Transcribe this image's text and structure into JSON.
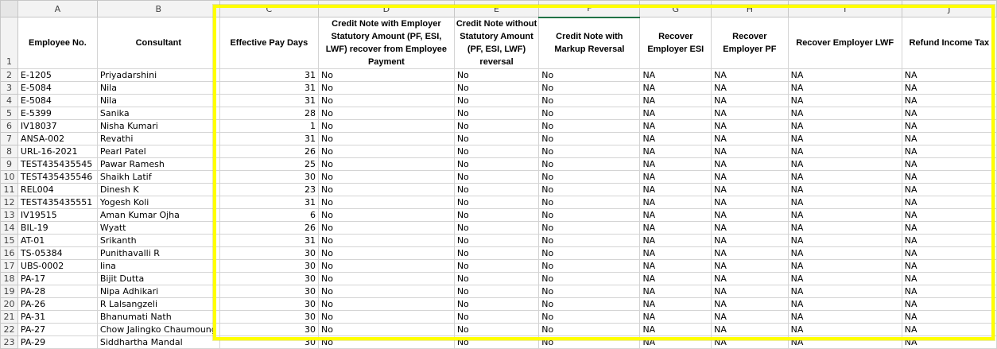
{
  "columns": [
    "A",
    "B",
    "C",
    "D",
    "E",
    "F",
    "G",
    "H",
    "I",
    "J"
  ],
  "header_row_number": "1",
  "headers": [
    "Employee No.",
    "Consultant",
    "Effective Pay Days",
    "Credit Note with Employer Statutory Amount (PF, ESI, LWF) recover from Employee Payment",
    "Credit Note without Statutory Amount (PF, ESI, LWF) reversal",
    "Credit Note with Markup Reversal",
    "Recover Employer ESI",
    "Recover Employer PF",
    "Recover Employer LWF",
    "Refund Income Tax"
  ],
  "rows": [
    {
      "num": "2",
      "emp": "E-1205",
      "consultant": "Priyadarshini",
      "days": "31",
      "d": "No",
      "e": "No",
      "f": "No",
      "g": "NA",
      "h": "NA",
      "i": "NA",
      "j": "NA"
    },
    {
      "num": "3",
      "emp": "E-5084",
      "consultant": "Nila",
      "days": "31",
      "d": "No",
      "e": "No",
      "f": "No",
      "g": "NA",
      "h": "NA",
      "i": "NA",
      "j": "NA"
    },
    {
      "num": "4",
      "emp": "E-5084",
      "consultant": "Nila",
      "days": "31",
      "d": "No",
      "e": "No",
      "f": "No",
      "g": "NA",
      "h": "NA",
      "i": "NA",
      "j": "NA"
    },
    {
      "num": "5",
      "emp": "E-5399",
      "consultant": "Sanika",
      "days": "28",
      "d": "No",
      "e": "No",
      "f": "No",
      "g": "NA",
      "h": "NA",
      "i": "NA",
      "j": "NA"
    },
    {
      "num": "6",
      "emp": "IV18037",
      "consultant": "Nisha Kumari",
      "days": "1",
      "d": "No",
      "e": "No",
      "f": "No",
      "g": "NA",
      "h": "NA",
      "i": "NA",
      "j": "NA"
    },
    {
      "num": "7",
      "emp": "ANSA-002",
      "consultant": "Revathi",
      "days": "31",
      "d": "No",
      "e": "No",
      "f": "No",
      "g": "NA",
      "h": "NA",
      "i": "NA",
      "j": "NA"
    },
    {
      "num": "8",
      "emp": "URL-16-2021",
      "consultant": "Pearl Patel",
      "days": "26",
      "d": "No",
      "e": "No",
      "f": "No",
      "g": "NA",
      "h": "NA",
      "i": "NA",
      "j": "NA"
    },
    {
      "num": "9",
      "emp": "TEST435435545",
      "consultant": "Pawar Ramesh",
      "days": "25",
      "d": "No",
      "e": "No",
      "f": "No",
      "g": "NA",
      "h": "NA",
      "i": "NA",
      "j": "NA"
    },
    {
      "num": "10",
      "emp": "TEST435435546",
      "consultant": "Shaikh Latif",
      "days": "30",
      "d": "No",
      "e": "No",
      "f": "No",
      "g": "NA",
      "h": "NA",
      "i": "NA",
      "j": "NA"
    },
    {
      "num": "11",
      "emp": "REL004",
      "consultant": "Dinesh K",
      "days": "23",
      "d": "No",
      "e": "No",
      "f": "No",
      "g": "NA",
      "h": "NA",
      "i": "NA",
      "j": "NA"
    },
    {
      "num": "12",
      "emp": "TEST435435551",
      "consultant": "Yogesh Koli",
      "days": "31",
      "d": "No",
      "e": "No",
      "f": "No",
      "g": "NA",
      "h": "NA",
      "i": "NA",
      "j": "NA"
    },
    {
      "num": "13",
      "emp": "IV19515",
      "consultant": "Aman Kumar Ojha",
      "days": "6",
      "d": "No",
      "e": "No",
      "f": "No",
      "g": "NA",
      "h": "NA",
      "i": "NA",
      "j": "NA"
    },
    {
      "num": "14",
      "emp": "BIL-19",
      "consultant": "Wyatt",
      "days": "26",
      "d": "No",
      "e": "No",
      "f": "No",
      "g": "NA",
      "h": "NA",
      "i": "NA",
      "j": "NA"
    },
    {
      "num": "15",
      "emp": "AT-01",
      "consultant": "Srikanth",
      "days": "31",
      "d": "No",
      "e": "No",
      "f": "No",
      "g": "NA",
      "h": "NA",
      "i": "NA",
      "j": "NA"
    },
    {
      "num": "16",
      "emp": "TS-05384",
      "consultant": "Punithavalli R",
      "days": "30",
      "d": "No",
      "e": "No",
      "f": "No",
      "g": "NA",
      "h": "NA",
      "i": "NA",
      "j": "NA"
    },
    {
      "num": "17",
      "emp": "UBS-0002",
      "consultant": "Iina",
      "days": "30",
      "d": "No",
      "e": "No",
      "f": "No",
      "g": "NA",
      "h": "NA",
      "i": "NA",
      "j": "NA"
    },
    {
      "num": "18",
      "emp": "PA-17",
      "consultant": "Bijit Dutta",
      "days": "30",
      "d": "No",
      "e": "No",
      "f": "No",
      "g": "NA",
      "h": "NA",
      "i": "NA",
      "j": "NA"
    },
    {
      "num": "19",
      "emp": "PA-28",
      "consultant": "Nipa Adhikari",
      "days": "30",
      "d": "No",
      "e": "No",
      "f": "No",
      "g": "NA",
      "h": "NA",
      "i": "NA",
      "j": "NA"
    },
    {
      "num": "20",
      "emp": "PA-26",
      "consultant": "R Lalsangzeli",
      "days": "30",
      "d": "No",
      "e": "No",
      "f": "No",
      "g": "NA",
      "h": "NA",
      "i": "NA",
      "j": "NA"
    },
    {
      "num": "21",
      "emp": "PA-31",
      "consultant": "Bhanumati Nath",
      "days": "30",
      "d": "No",
      "e": "No",
      "f": "No",
      "g": "NA",
      "h": "NA",
      "i": "NA",
      "j": "NA"
    },
    {
      "num": "22",
      "emp": "PA-27",
      "consultant": "Chow Jalingko Chaumoung",
      "days": "30",
      "d": "No",
      "e": "No",
      "f": "No",
      "g": "NA",
      "h": "NA",
      "i": "NA",
      "j": "NA"
    },
    {
      "num": "23",
      "emp": "PA-29",
      "consultant": "Siddhartha Mandal",
      "days": "30",
      "d": "No",
      "e": "No",
      "f": "No",
      "g": "NA",
      "h": "NA",
      "i": "NA",
      "j": "NA"
    }
  ],
  "highlight_color": "#ffff00",
  "selected_column_color": "#217346"
}
